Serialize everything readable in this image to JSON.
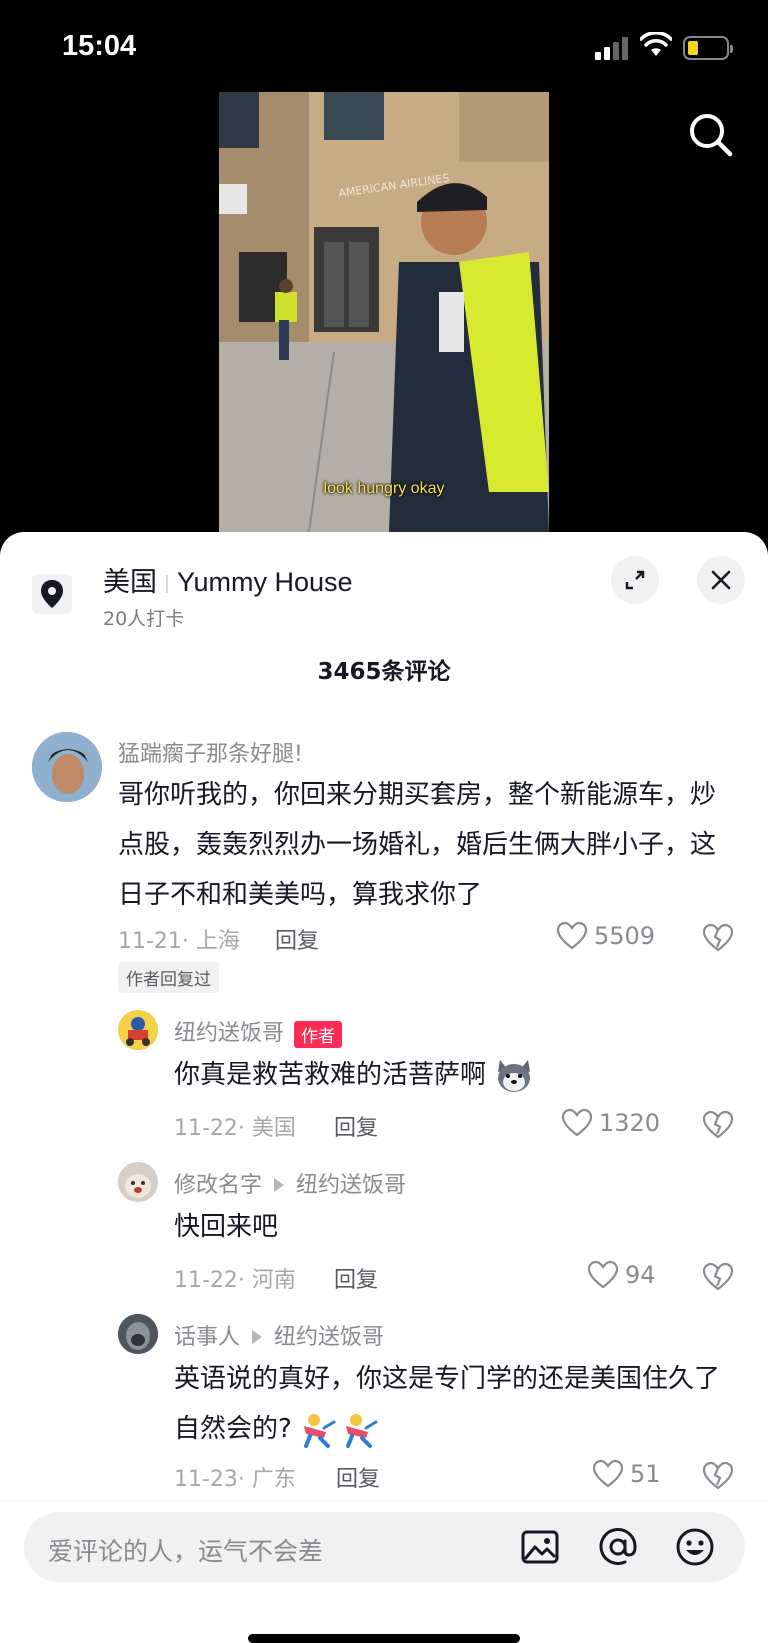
{
  "status": {
    "time": "15:04"
  },
  "video": {
    "caption": "look hungry okay",
    "building_sign": "AMERICAN AIRLINES"
  },
  "location": {
    "country": "美国",
    "name": "Yummy House",
    "checkins": "20人打卡"
  },
  "comments_header": {
    "title": "3465条评论"
  },
  "comments": [
    {
      "user": "猛踹瘸子那条好腿!",
      "text": "哥你听我的，你回来分期买套房，整个新能源车，炒点股，轰轰烈烈办一场婚礼，婚后生俩大胖小子，这日子不和和美美吗，算我求你了",
      "meta": "11-21· 上海",
      "reply": "回复",
      "likes": "5509",
      "tag": "作者回复过"
    },
    {
      "user": "纽约送饭哥",
      "badge": "作者",
      "text": "你真是救苦救难的活菩萨啊",
      "meta": "11-22· 美国",
      "reply": "回复",
      "likes": "1320"
    },
    {
      "user": "修改名字",
      "reply_to": "纽约送饭哥",
      "text": "快回来吧",
      "meta": "11-22· 河南",
      "reply": "回复",
      "likes": "94"
    },
    {
      "user": "话事人",
      "reply_to": "纽约送饭哥",
      "text": "英语说的真好，你这是专门学的还是美国住久了自然会的?",
      "meta": "11-23· 广东",
      "reply": "回复",
      "likes": "51"
    }
  ],
  "input": {
    "placeholder": "爱评论的人，运气不会差"
  },
  "icons": {
    "search": "search-icon",
    "location": "location-pin-icon",
    "expand": "expand-icon",
    "close": "close-icon",
    "like": "heart-icon",
    "dislike": "broken-heart-icon",
    "image": "image-icon",
    "mention": "at-icon",
    "emoji": "emoji-icon"
  },
  "colors": {
    "accent": "#fe2c55",
    "caption": "#f4e24a"
  }
}
